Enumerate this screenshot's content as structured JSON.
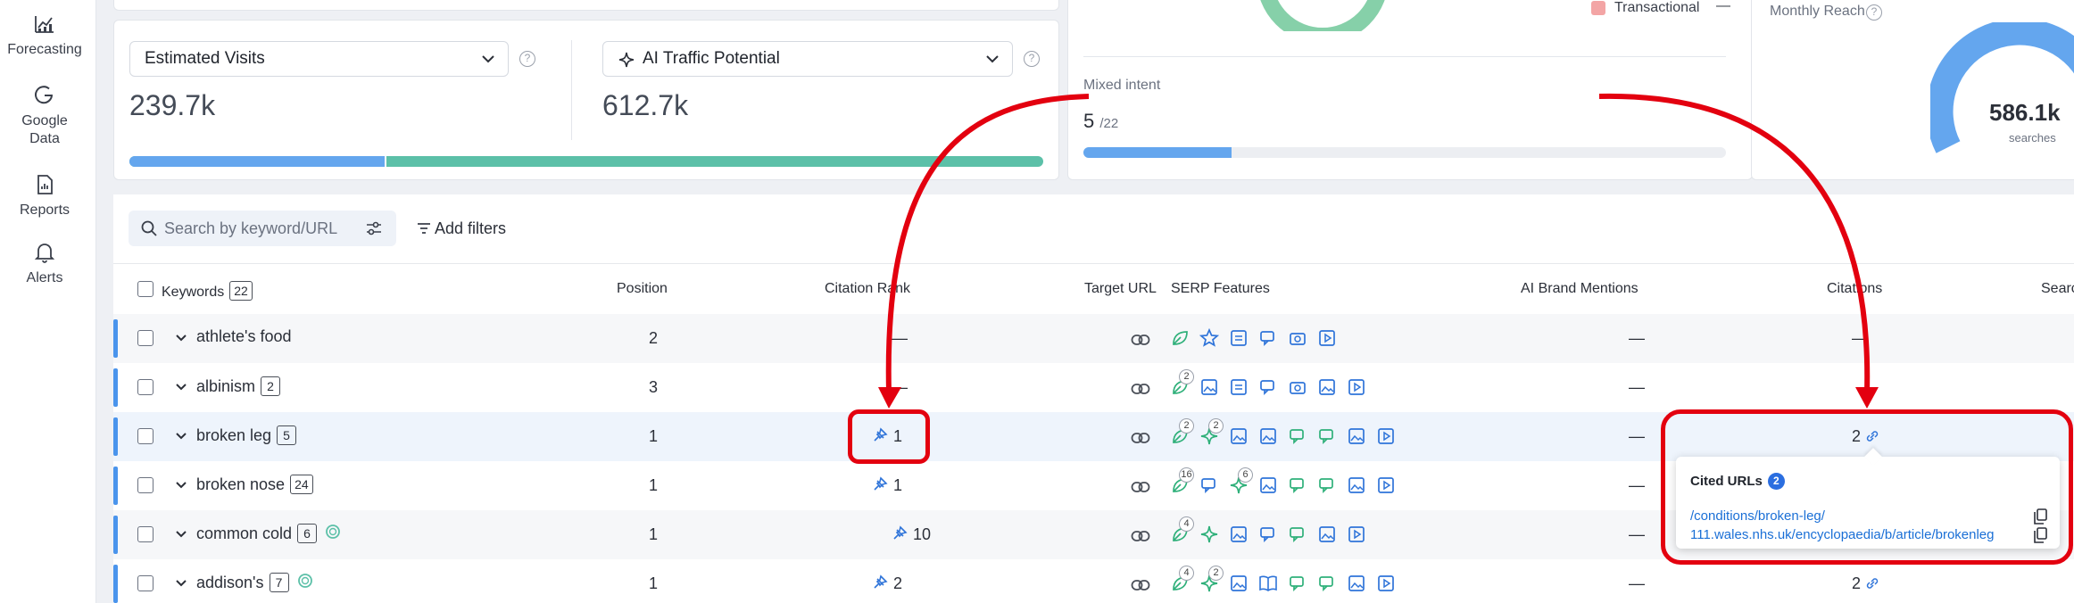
{
  "nav": [
    {
      "label": "Forecasting",
      "icon": "forecasting-icon"
    },
    {
      "label": "Google Data",
      "icon": "google-icon"
    },
    {
      "label": "Reports",
      "icon": "reports-icon"
    },
    {
      "label": "Alerts",
      "icon": "bell-icon"
    }
  ],
  "metrics": {
    "left": {
      "label": "Estimated Visits",
      "value": "239.7k"
    },
    "right": {
      "label": "AI Traffic Potential",
      "value": "612.7k"
    }
  },
  "intent": {
    "legend_label": "Transactional",
    "legend_value": "—",
    "mixed_label": "Mixed intent",
    "mixed_value": "5",
    "mixed_total": "/22",
    "mixed_progress": 0.23
  },
  "reach": {
    "label": "Monthly Reach",
    "value": "586.1k",
    "unit": "searches"
  },
  "filters": {
    "search_placeholder": "Search by keyword/URL",
    "add_filters": "Add filters"
  },
  "table": {
    "headers": {
      "keywords": "Keywords",
      "keywords_count": "22",
      "position": "Position",
      "citation_rank": "Citation Rank",
      "target_url": "Target URL",
      "serp_features": "SERP Features",
      "ai_brand_mentions": "AI Brand Mentions",
      "citations": "Citations",
      "search": "Searc"
    },
    "rows": [
      {
        "keyword": "athlete's food",
        "count": "",
        "position": "2",
        "citation_rank": "—",
        "ai_brand": "—",
        "citations": "—"
      },
      {
        "keyword": "albinism",
        "count": "2",
        "position": "3",
        "citation_rank": "—",
        "ai_brand": "—",
        "citations": ""
      },
      {
        "keyword": "broken leg",
        "count": "5",
        "position": "1",
        "citation_rank": "1",
        "ai_brand": "—",
        "citations": "2"
      },
      {
        "keyword": "broken nose",
        "count": "24",
        "position": "1",
        "citation_rank": "1",
        "ai_brand": "—",
        "citations": ""
      },
      {
        "keyword": "common cold",
        "count": "6",
        "position": "1",
        "citation_rank": "10",
        "ai_brand": "—",
        "citations": ""
      },
      {
        "keyword": "addison's",
        "count": "7",
        "position": "1",
        "citation_rank": "2",
        "ai_brand": "—",
        "citations": "2"
      }
    ]
  },
  "popup": {
    "title": "Cited URLs",
    "count": "2",
    "urls": [
      "/conditions/broken-leg/",
      "111.wales.nhs.uk/encyclopaedia/b/article/brokenleg"
    ]
  },
  "colors": {
    "accent_blue": "#4a94ec",
    "accent_teal": "#5cc0a8",
    "annotation_red": "#e3000f",
    "serp_green": "#2fb07a",
    "serp_blue": "#2f74d9"
  }
}
